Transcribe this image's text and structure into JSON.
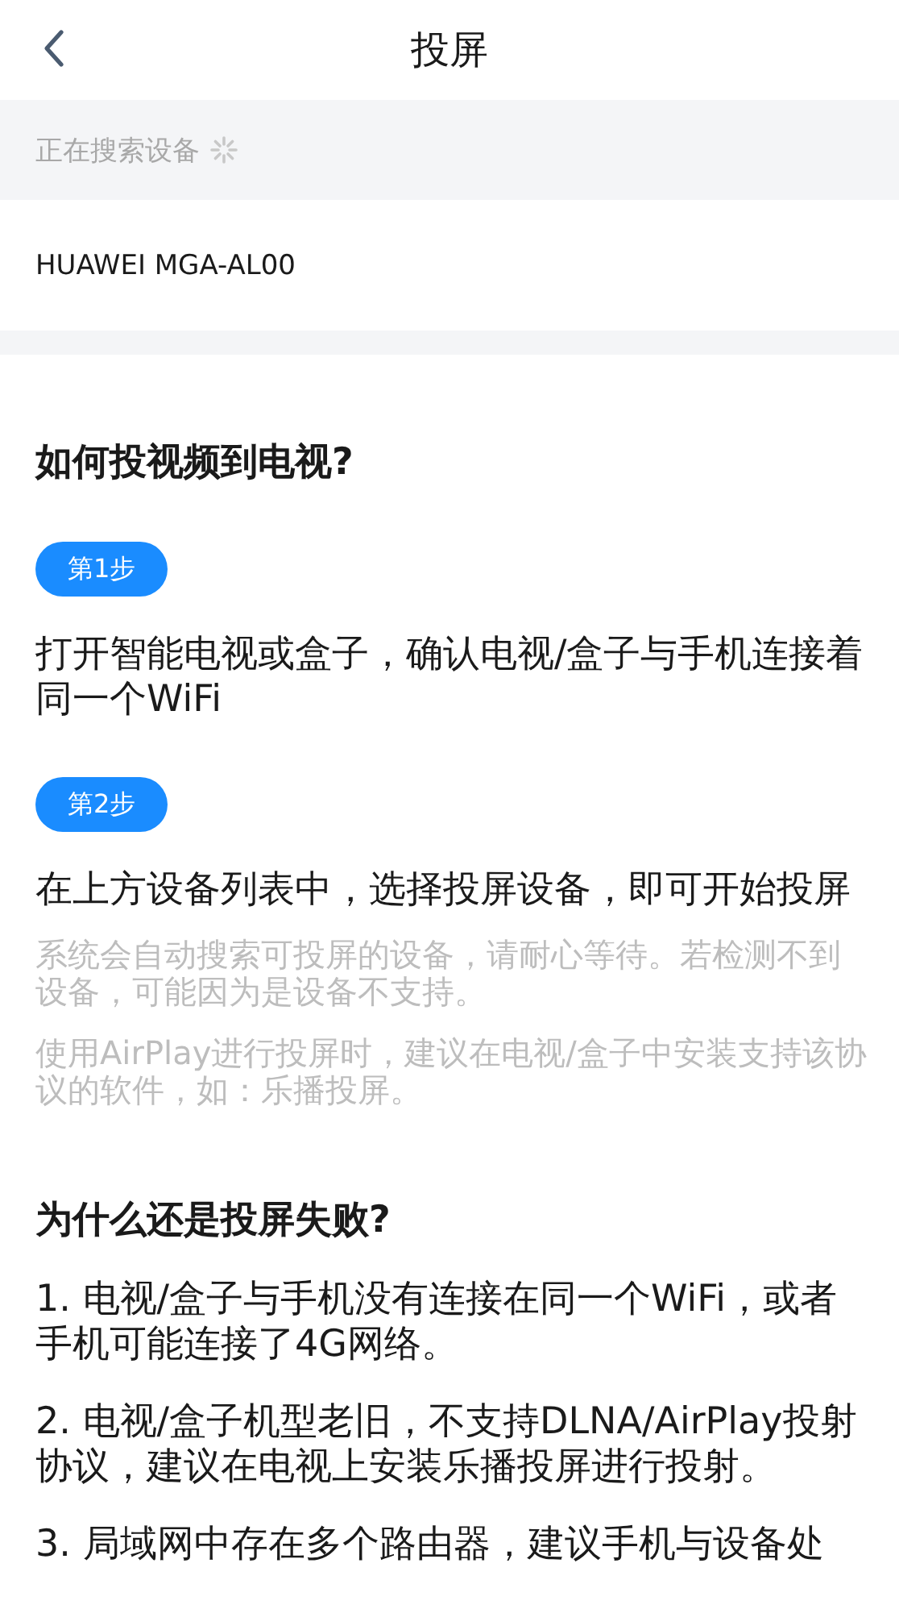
{
  "header": {
    "title": "投屏"
  },
  "search_status": {
    "text": "正在搜索设备"
  },
  "devices": [
    {
      "name": "HUAWEI MGA-AL00"
    }
  ],
  "guide": {
    "title": "如何投视频到电视?",
    "steps": [
      {
        "label": "第1步",
        "text": "打开智能电视或盒子，确认电视/盒子与手机连接着同一个WiFi"
      },
      {
        "label": "第2步",
        "text": "在上方设备列表中，选择投屏设备，即可开始投屏",
        "notes": [
          "系统会自动搜索可投屏的设备，请耐心等待。若检测不到设备，可能因为是设备不支持。",
          "使用AirPlay进行投屏时，建议在电视/盒子中安装支持该协议的软件，如：乐播投屏。"
        ]
      }
    ]
  },
  "faq": {
    "title": "为什么还是投屏失败?",
    "items": [
      "1. 电视/盒子与手机没有连接在同一个WiFi，或者手机可能连接了4G网络。",
      "2. 电视/盒子机型老旧，不支持DLNA/AirPlay投射协议，建议在电视上安装乐播投屏进行投射。",
      "3. 局域网中存在多个路由器，建议手机与设备处"
    ]
  }
}
